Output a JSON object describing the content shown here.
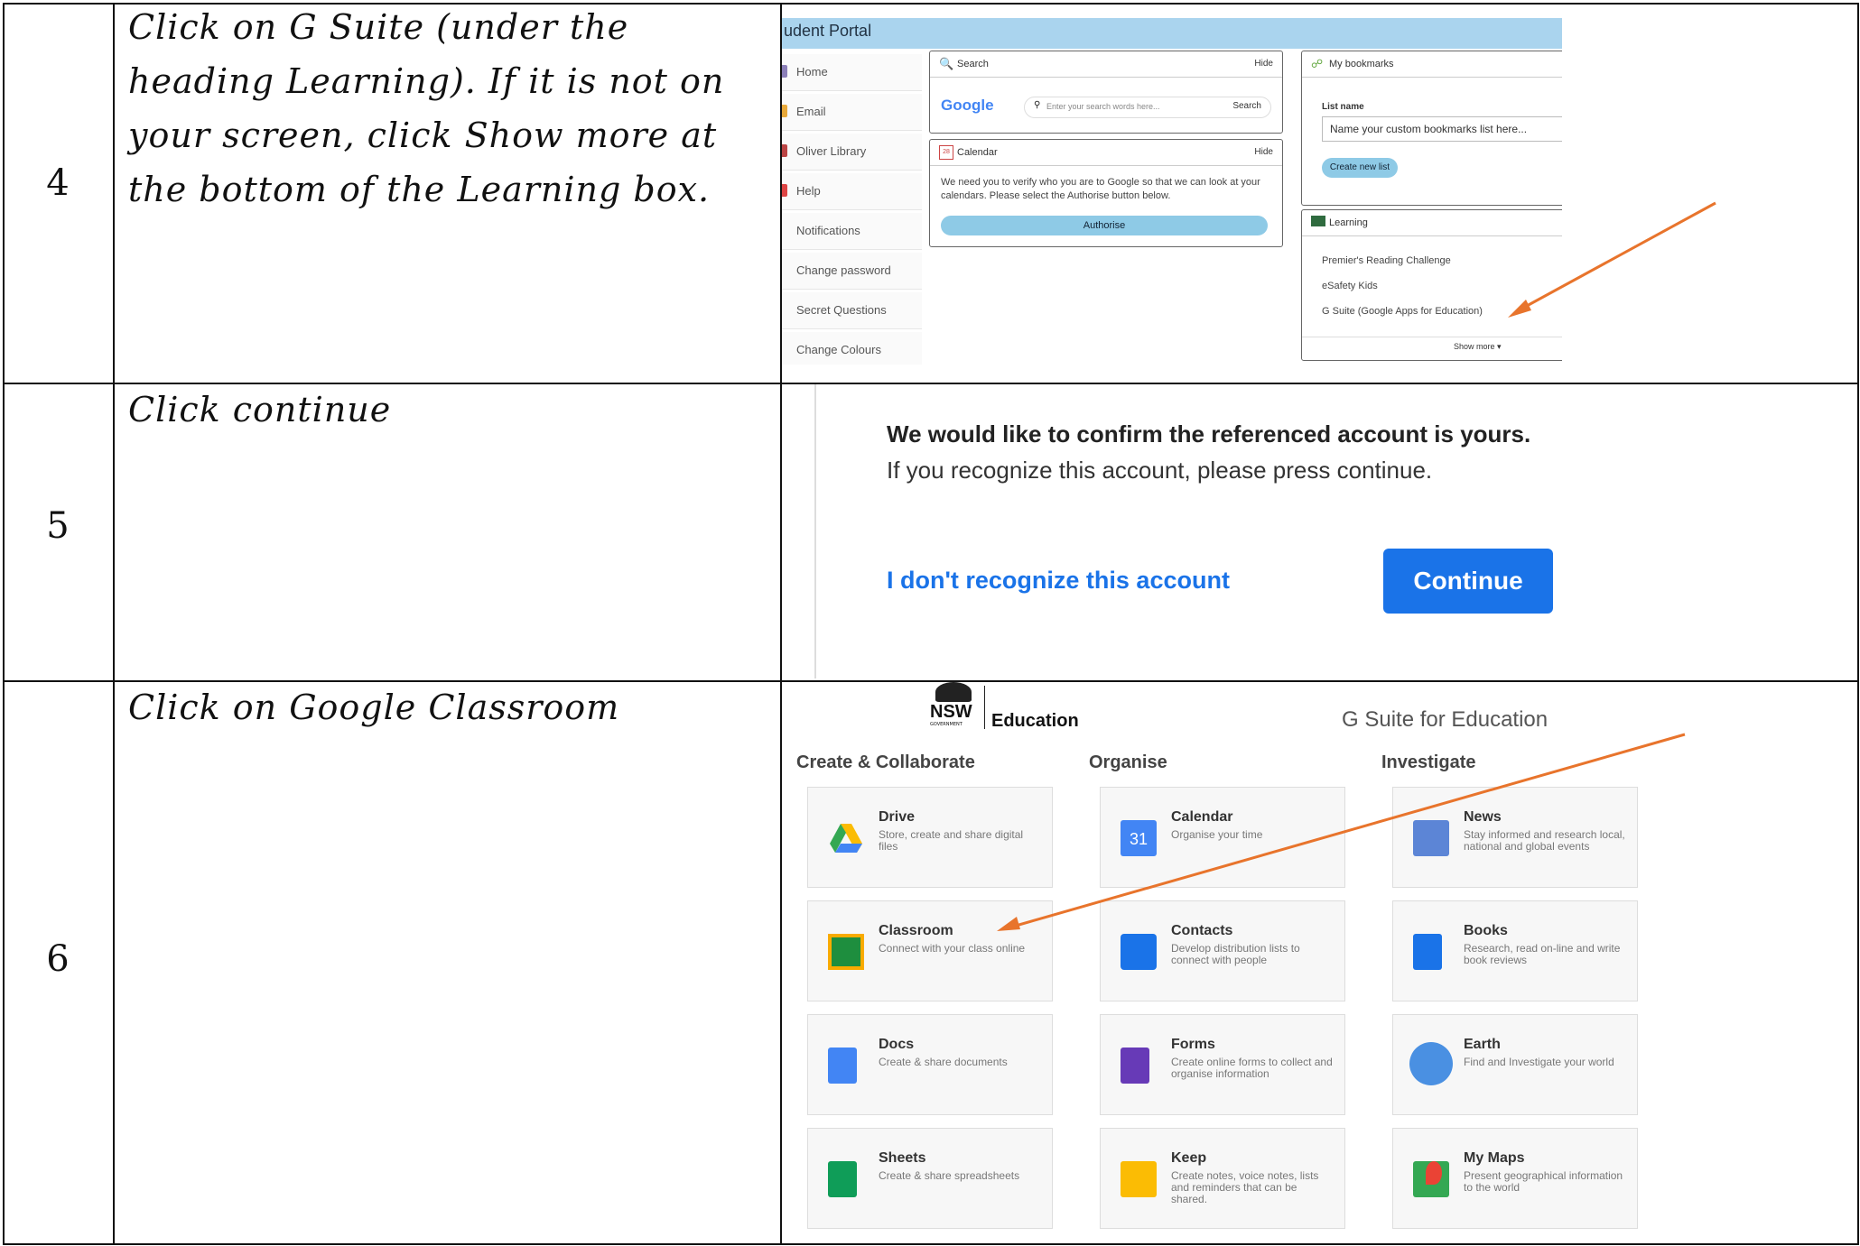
{
  "rows": [
    {
      "number": "4",
      "instruction": "Click on G Suite (under the heading Learning). If it is not on your screen, click Show more at the bottom of the Learning box."
    },
    {
      "number": "5",
      "instruction": "Click continue"
    },
    {
      "number": "6",
      "instruction": "Click on Google Classroom"
    }
  ],
  "portal": {
    "title": "udent Portal",
    "sidebar": [
      "Home",
      "Email",
      "Oliver Library",
      "Help",
      "Notifications",
      "Change password",
      "Secret Questions",
      "Change Colours"
    ],
    "search": {
      "title": "Search",
      "hide": "Hide",
      "logo": "Google",
      "placeholder": "Enter your search words here...",
      "button": "Search"
    },
    "calendar": {
      "title": "Calendar",
      "hide": "Hide",
      "icon_text": "28",
      "text": "We need you to verify who you are to Google so that we can look at your calendars. Please select the Authorise button below.",
      "button": "Authorise"
    },
    "bookmarks": {
      "title": "My bookmarks",
      "list_label": "List name",
      "placeholder": "Name your custom bookmarks list here...",
      "button": "Create new list"
    },
    "learning": {
      "title": "Learning",
      "items": [
        "Premier's Reading Challenge",
        "eSafety Kids",
        "G Suite (Google Apps for Education)"
      ],
      "show_more": "Show more ▾"
    }
  },
  "confirm": {
    "heading": "We would like to confirm the referenced account is yours.",
    "subtext": "If you recognize this account, please press continue.",
    "link": "I don't recognize this account",
    "button": "Continue"
  },
  "gsuite": {
    "nsw_logo": "NSW",
    "nsw_sub": "GOVERNMENT",
    "education": "Education",
    "brand": "G Suite for Education",
    "columns": [
      "Create & Collaborate",
      "Organise",
      "Investigate"
    ],
    "apps": [
      {
        "name": "Drive",
        "desc": "Store, create and share digital files",
        "icon": "drive-icon"
      },
      {
        "name": "Calendar",
        "desc": "Organise your time",
        "icon": "calendar-icon",
        "icon_text": "31"
      },
      {
        "name": "News",
        "desc": "Stay informed and research local, national and global events",
        "icon": "news-icon"
      },
      {
        "name": "Classroom",
        "desc": "Connect with your class online",
        "icon": "classroom-icon"
      },
      {
        "name": "Contacts",
        "desc": "Develop distribution lists to connect with people",
        "icon": "contacts-icon"
      },
      {
        "name": "Books",
        "desc": "Research, read on-line and write book reviews",
        "icon": "books-icon"
      },
      {
        "name": "Docs",
        "desc": "Create & share documents",
        "icon": "docs-icon"
      },
      {
        "name": "Forms",
        "desc": "Create online forms to collect and organise information",
        "icon": "forms-icon"
      },
      {
        "name": "Earth",
        "desc": "Find and Investigate your world",
        "icon": "earth-icon"
      },
      {
        "name": "Sheets",
        "desc": "Create & share spreadsheets",
        "icon": "sheets-icon"
      },
      {
        "name": "Keep",
        "desc": "Create notes, voice notes, lists and reminders that can be shared.",
        "icon": "keep-icon"
      },
      {
        "name": "My Maps",
        "desc": "Present geographical information to the world",
        "icon": "maps-icon"
      }
    ]
  },
  "colors": {
    "arrow": "#e8742c",
    "google_blue": "#1a73e8",
    "portal_header": "#aad4ee"
  }
}
